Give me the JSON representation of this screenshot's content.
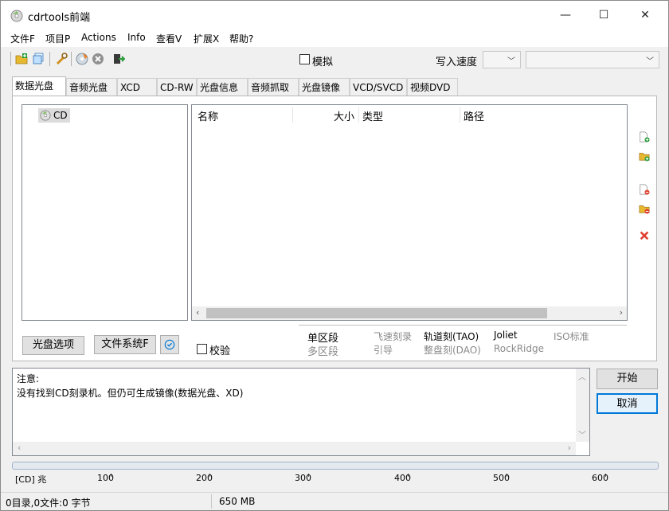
{
  "window": {
    "title": "cdrtools前端",
    "minimize": "—",
    "maximize": "☐",
    "close": "✕"
  },
  "menu": [
    "文件F",
    "项目P",
    "Actions",
    "Info",
    "查看V",
    "扩展X",
    "帮助?"
  ],
  "toolbar": {
    "simulate_label": "模拟",
    "write_speed_label": "写入速度",
    "speed_value": "",
    "drive_value": ""
  },
  "tabs": [
    "数据光盘",
    "音频光盘",
    "XCD",
    "CD-RW",
    "光盘信息",
    "音频抓取",
    "光盘镜像",
    "VCD/SVCD",
    "视频DVD"
  ],
  "tree": {
    "root_label": "CD"
  },
  "filelist": {
    "columns": [
      "名称",
      "大小",
      "类型",
      "路径"
    ]
  },
  "buttons": {
    "disc_options": "光盘选项",
    "filesystem": "文件系统F",
    "verify_label": "校验",
    "start": "开始",
    "cancel": "取消"
  },
  "session_options": {
    "single_session": "单区段",
    "multi_session": "多区段",
    "on_the_fly": "飞速刻录",
    "boot": "引导",
    "tao": "轨道刻(TAO)",
    "dao": "整盘刻(DAO)",
    "joliet": "Joliet",
    "rockridge": "RockRidge",
    "iso_standard": "ISO标准"
  },
  "notes": {
    "title": "注意:",
    "message": "没有找到CD刻录机。但仍可生成镜像(数据光盘、XD)"
  },
  "ruler": {
    "unit_label": "[CD] 兆",
    "ticks": [
      "100",
      "200",
      "300",
      "400",
      "500",
      "600"
    ]
  },
  "status": {
    "counts": "0目录,0文件:0 字节",
    "capacity": "650 MB"
  },
  "colors": {
    "accent": "#0078d7",
    "delete_red": "#e04030",
    "folder_yellow": "#e8b830",
    "add_green": "#2a9d3c"
  }
}
